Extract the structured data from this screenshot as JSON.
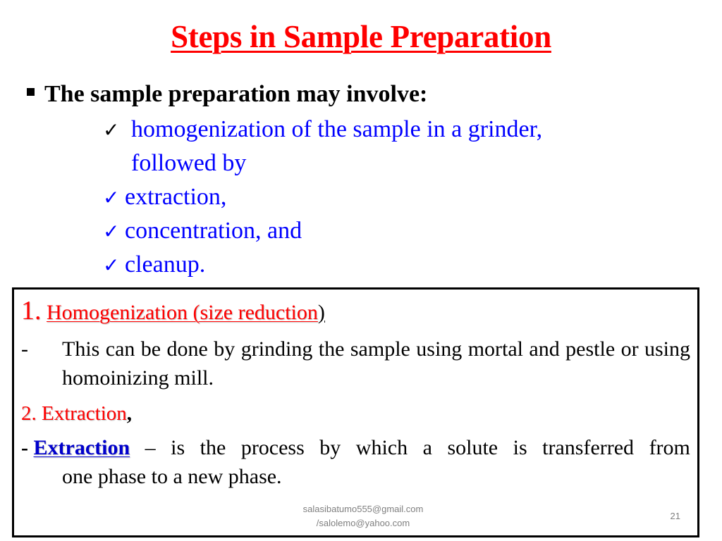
{
  "slide": {
    "title": "Steps in Sample Preparation",
    "lead": {
      "bullet_icon": "square-bullet-icon",
      "text": "The sample preparation may involve:"
    },
    "checklist": [
      {
        "icon": "check-icon",
        "text": "homogenization of the sample in a grinder,",
        "continuation": "followed by"
      },
      {
        "icon": "check-icon",
        "text": "extraction,"
      },
      {
        "icon": "check-icon",
        "text": "concentration, and"
      },
      {
        "icon": "check-icon",
        "text": "cleanup."
      }
    ],
    "check_glyph": "✓",
    "box": {
      "section1": {
        "number": "1.",
        "heading": "Homogenization (size reduction",
        "closing": ")",
        "bullet": "-",
        "body": "This can be done by grinding the sample using mortal and pestle or using homoinizing mill."
      },
      "section2": {
        "heading": "2. Extraction",
        "trailing": ",",
        "bullet": "-",
        "keyword": "Extraction",
        "definition_words": [
          "–",
          "is",
          "the",
          "process",
          "by",
          "which",
          "a",
          "solute",
          "is",
          "transferred",
          "from"
        ],
        "definition_line2": "one phase to a new phase."
      }
    },
    "footer": {
      "email_line1": "salasibatumo555@gmail.com",
      "email_line2": "/salolemo@yahoo.com",
      "page_number": "21"
    },
    "colors": {
      "title": "#ff0000",
      "checklist_text": "#0000ff",
      "keyword": "#0000cc",
      "footer": "#7f7f7f"
    }
  }
}
